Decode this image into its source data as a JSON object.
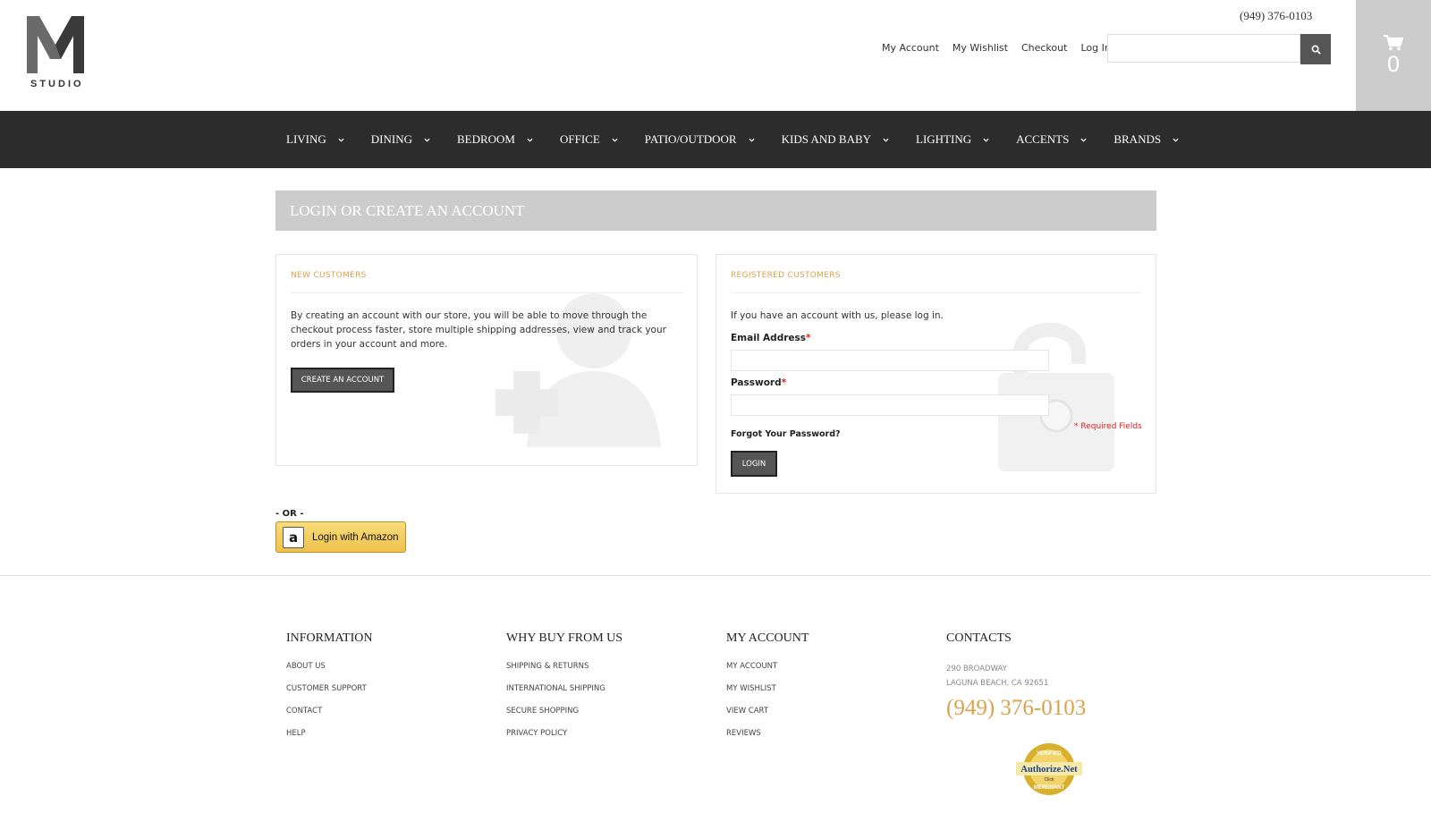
{
  "header": {
    "logo_alt": "M STUDIO",
    "logo_text": "STUDIO",
    "phone": "(949) 376-0103",
    "links": [
      "My Account",
      "My Wishlist",
      "Checkout",
      "Log In"
    ],
    "search_placeholder": "",
    "cart_count": "0"
  },
  "nav": {
    "items": [
      "LIVING",
      "DINING",
      "BEDROOM",
      "OFFICE",
      "PATIO/OUTDOOR",
      "KIDS AND BABY",
      "LIGHTING",
      "ACCENTS",
      "BRANDS"
    ]
  },
  "page": {
    "title": "LOGIN OR CREATE AN ACCOUNT"
  },
  "new_customers": {
    "heading": "NEW CUSTOMERS",
    "text": "By creating an account with our store, you will be able to move through the checkout process faster, store multiple shipping addresses, view and track your orders in your account and more.",
    "button": "CREATE AN ACCOUNT"
  },
  "registered": {
    "heading": "REGISTERED CUSTOMERS",
    "text": "If you have an account with us, please log in.",
    "email_label": "Email Address",
    "password_label": "Password",
    "required_mark": "*",
    "email_value": "",
    "password_value": "",
    "forgot": "Forgot Your Password?",
    "required_note": "* Required Fields",
    "login_button": "LOGIN"
  },
  "alt_login": {
    "or_text": "- OR -",
    "amazon_label": "Login with Amazon",
    "amazon_icon": "a"
  },
  "footer": {
    "information": {
      "title": "INFORMATION",
      "links": [
        "About Us",
        "Customer Support",
        "Contact",
        "Help"
      ]
    },
    "why_buy": {
      "title": "WHY BUY FROM US",
      "links": [
        "Shipping & Returns",
        "International Shipping",
        "Secure Shopping",
        "Privacy Policy"
      ]
    },
    "my_account": {
      "title": "MY ACCOUNT",
      "links": [
        "My Account",
        "My Wishlist",
        "View Cart",
        "Reviews"
      ]
    },
    "contacts": {
      "title": "CONTACTS",
      "address_line1": "290 BROADWAY",
      "address_line2": "LAGUNA BEACH, CA 92651",
      "phone": "(949) 376-0103",
      "seal_text": "Authorize.Net",
      "seal_top": "VERIFIED",
      "seal_bottom": "MERCHANT",
      "seal_click": "Click"
    }
  },
  "colors": {
    "accent": "#d9a34d",
    "nav_bg": "#2c2c2c",
    "title_bar": "#cccccc",
    "required": "#e02020"
  }
}
